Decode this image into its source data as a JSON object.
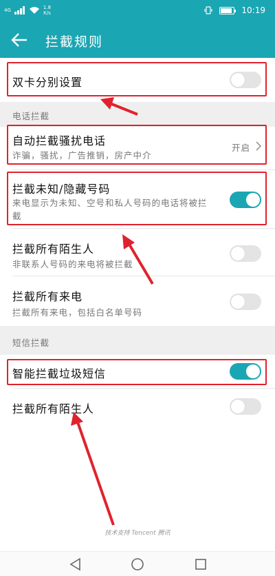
{
  "status_bar": {
    "network_tag": "4G",
    "speed_value": "1.8",
    "speed_unit": "K/s",
    "time": "10:19",
    "battery_level": 0.85
  },
  "app_bar": {
    "title": "拦截规则"
  },
  "rows": {
    "dual_sim": {
      "title": "双卡分别设置",
      "toggle_on": false
    },
    "auto_block": {
      "title": "自动拦截骚扰电话",
      "subtitle": "诈骗，骚扰，广告推销，房产中介",
      "status": "开启"
    },
    "unknown_numbers": {
      "title": "拦截未知/隐藏号码",
      "subtitle": "来电显示为未知、空号和私人号码的电话将被拦截",
      "toggle_on": true
    },
    "strangers_call": {
      "title": "拦截所有陌生人",
      "subtitle": "非联系人号码的来电将被拦截",
      "toggle_on": false
    },
    "all_calls": {
      "title": "拦截所有来电",
      "subtitle": "拦截所有来电，包括白名单号码",
      "toggle_on": false
    },
    "smart_sms": {
      "title": "智能拦截垃圾短信",
      "toggle_on": true
    },
    "strangers_sms": {
      "title": "拦截所有陌生人",
      "toggle_on": false
    }
  },
  "sections": {
    "phone": "电话拦截",
    "sms": "短信拦截"
  },
  "footer": "技术支持 Tencent 腾讯",
  "colors": {
    "accent": "#1ba6b3",
    "highlight": "#e0222d",
    "annotation_arrow": "#e0222d"
  }
}
